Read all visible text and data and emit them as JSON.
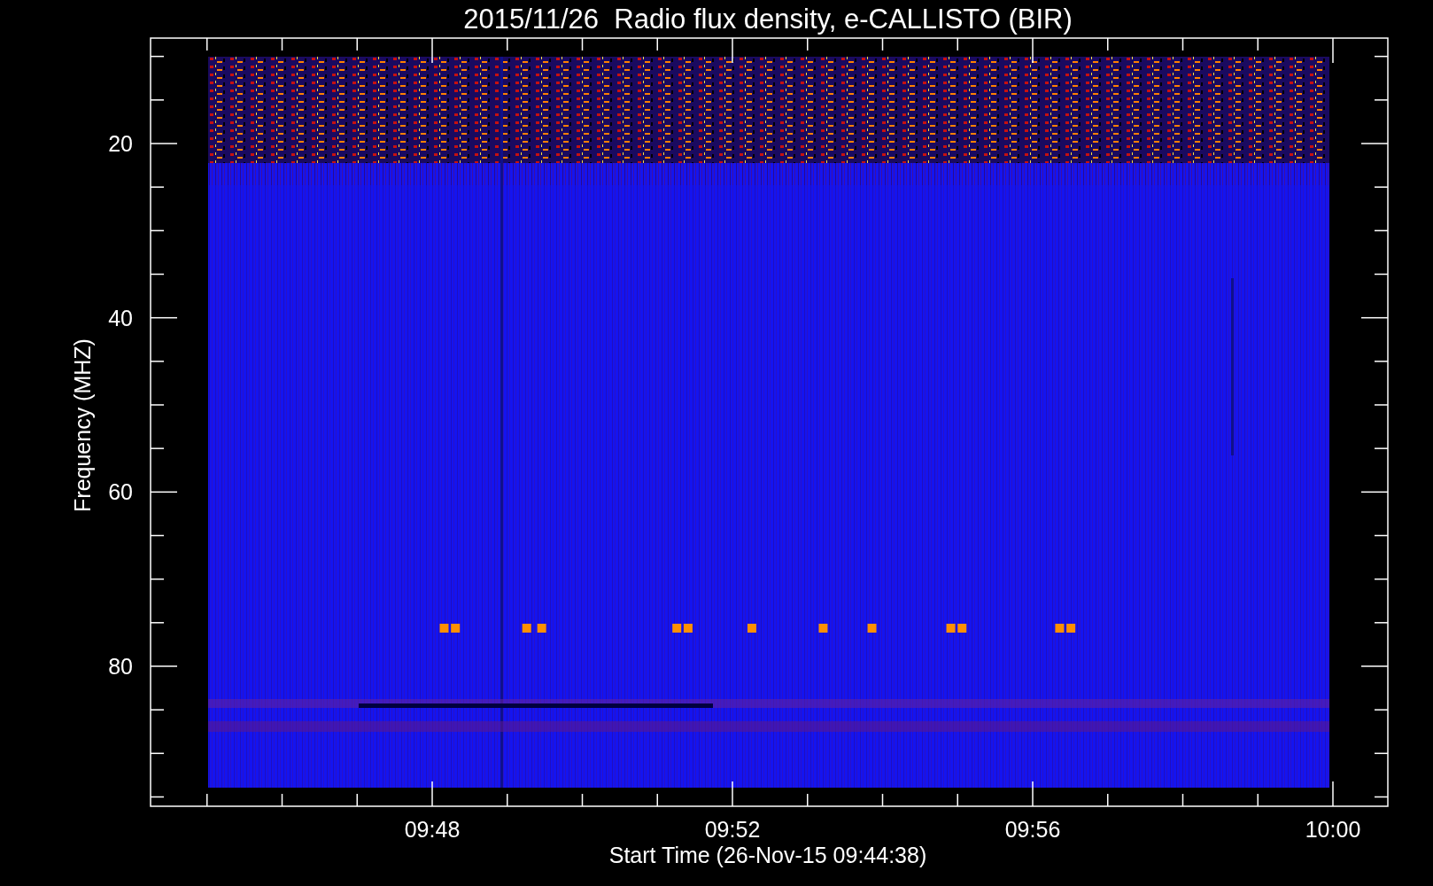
{
  "plot": {
    "title": "2015/11/26  Radio flux density, e-CALLISTO (BIR)",
    "ylabel": "Frequency (MHZ)",
    "xlabel": "Start Time (26-Nov-15 09:44:38)",
    "y_ticks": [
      "20",
      "40",
      "60",
      "80"
    ],
    "x_ticks": [
      "09:48",
      "09:52",
      "09:56",
      "10:00"
    ]
  }
}
